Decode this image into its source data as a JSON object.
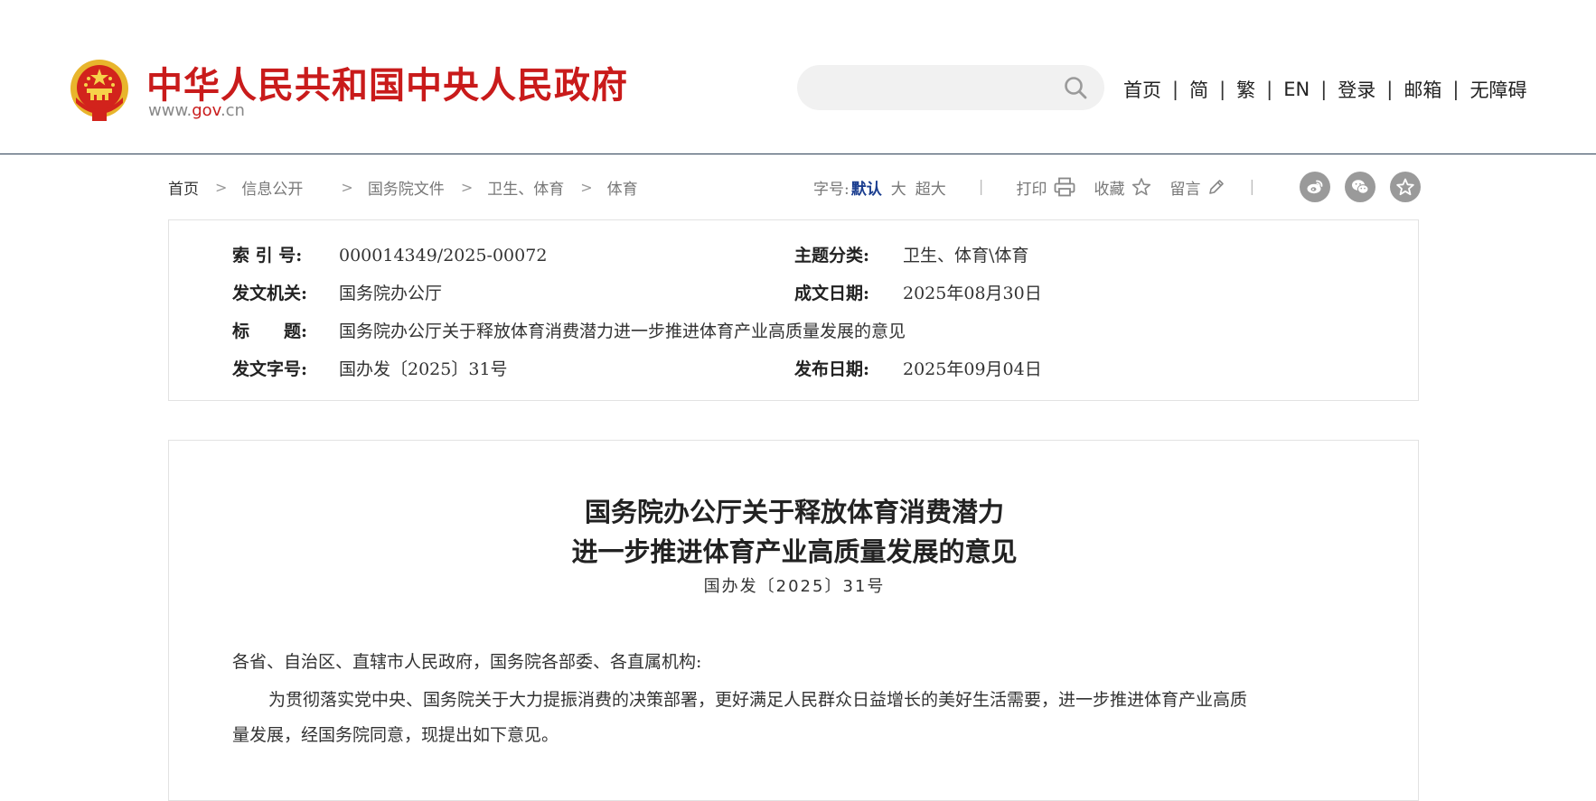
{
  "header": {
    "site_title": "中华人民共和国中央人民政府",
    "url_prefix": "www.",
    "url_gov": "gov",
    "url_suffix": ".cn",
    "search_placeholder": "",
    "nav": [
      "首页",
      "简",
      "繁",
      "EN",
      "登录",
      "邮箱",
      "无障碍"
    ],
    "nav_separator": "|",
    "colors": {
      "brand_red": "#c91b1b",
      "rule": "#2b3e55"
    }
  },
  "breadcrumb": [
    "首页",
    "信息公开",
    "国务院文件",
    "卫生、体育",
    "体育"
  ],
  "toolbar": {
    "font_size_label": "字号:",
    "font_sizes": [
      "默认",
      "大",
      "超大"
    ],
    "divider": "|",
    "print": "打印",
    "favorite": "收藏",
    "comment": "留言"
  },
  "share_icons": [
    "weibo-icon",
    "wechat-icon",
    "favorite-star-icon"
  ],
  "meta": {
    "index_no_label": "索 引 号:",
    "index_no": "000014349/2025-00072",
    "topic_label": "主题分类:",
    "topic": "卫生、体育\\体育",
    "issuer_label": "发文机关:",
    "issuer": "国务院办公厅",
    "written_date_label": "成文日期:",
    "written_date": "2025年08月30日",
    "title_label": "标　　题:",
    "title": "国务院办公厅关于释放体育消费潜力进一步推进体育产业高质量发展的意见",
    "doc_no_label": "发文字号:",
    "doc_no": "国办发〔2025〕31号",
    "publish_date_label": "发布日期:",
    "publish_date": "2025年09月04日"
  },
  "article": {
    "title_line1": "国务院办公厅关于释放体育消费潜力",
    "title_line2": "进一步推进体育产业高质量发展的意见",
    "doc_no": "国办发〔2025〕31号",
    "salutation": "各省、自治区、直辖市人民政府，国务院各部委、各直属机构:",
    "para1_line1": "为贯彻落实党中央、国务院关于大力提振消费的决策部署，更好满足人民群众日益增长的美好生活需要，进一步推进体育产业高质",
    "para1_line2": "量发展，经国务院同意，现提出如下意见。"
  }
}
